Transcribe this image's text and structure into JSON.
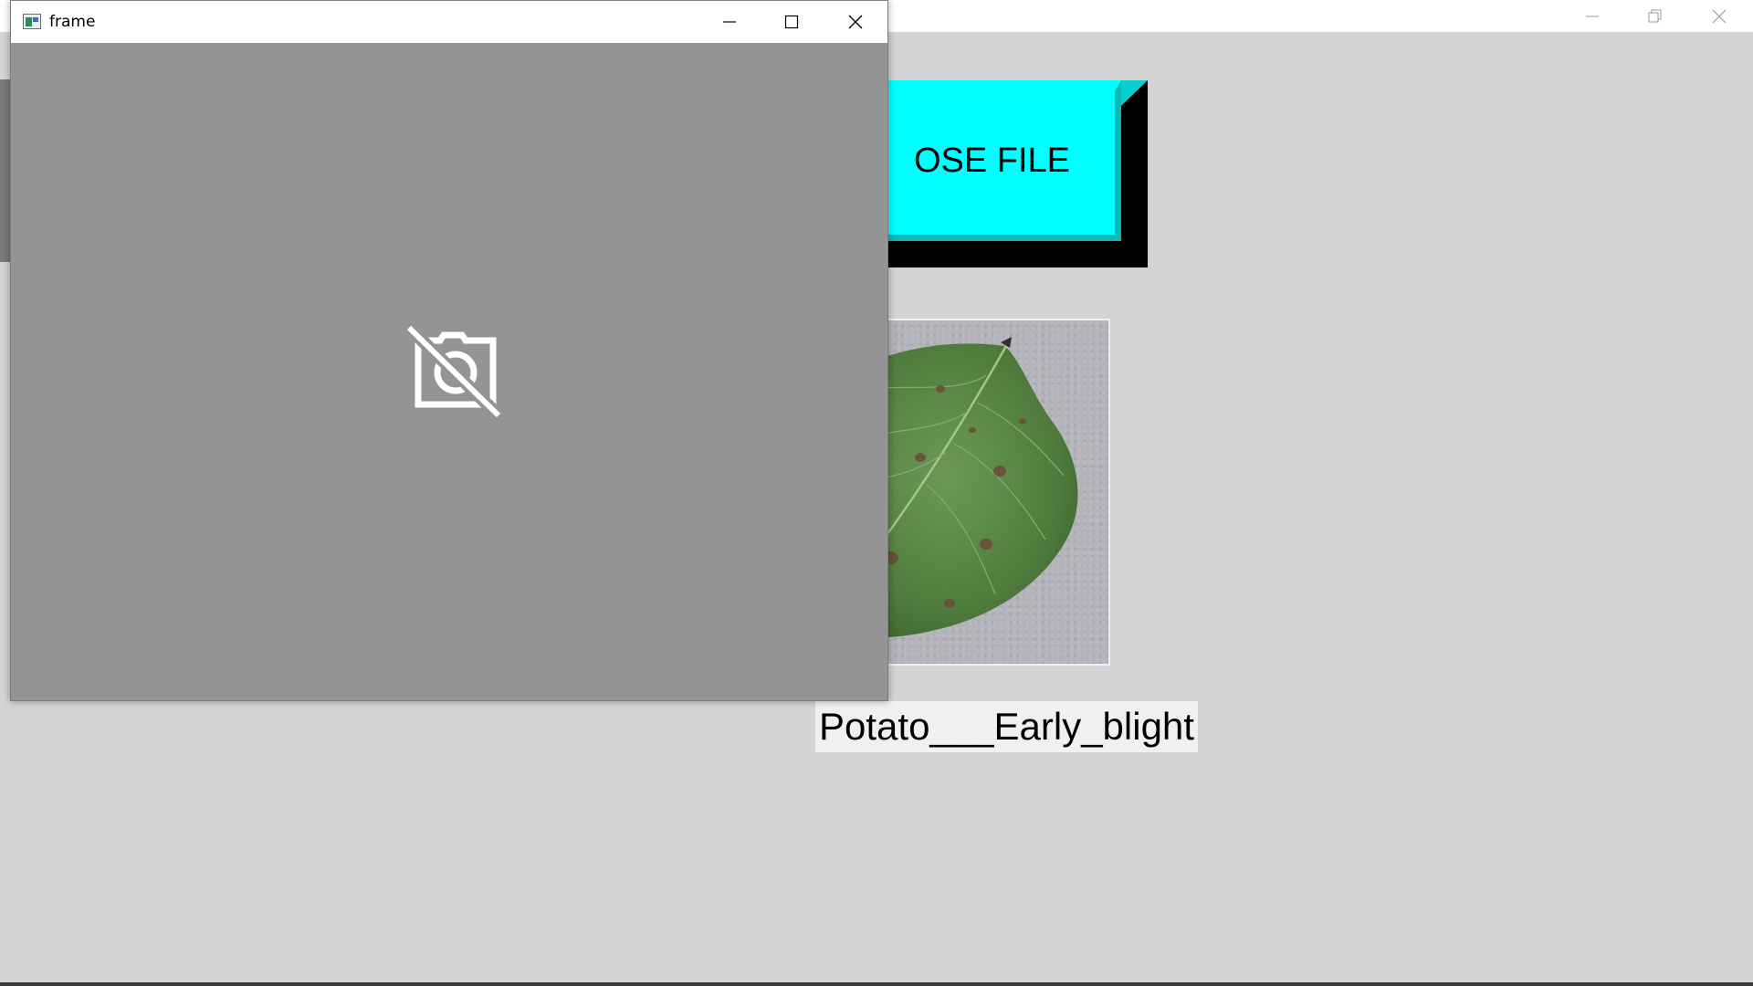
{
  "main_window": {
    "choose_file_button": {
      "label": "OSE FILE"
    },
    "prediction": {
      "text": "Potato___Early_blight"
    },
    "controls": [
      "minimize-icon",
      "restore-icon",
      "close-icon"
    ]
  },
  "frame_window": {
    "title": "frame",
    "controls": [
      "minimize-icon",
      "maximize-icon",
      "close-icon"
    ],
    "video_placeholder_icon": "camera-off-icon"
  },
  "colors": {
    "button_face": "#00ffff",
    "button_shadow": "#000000",
    "background": "#d4d4d4",
    "video_background": "#949496"
  }
}
